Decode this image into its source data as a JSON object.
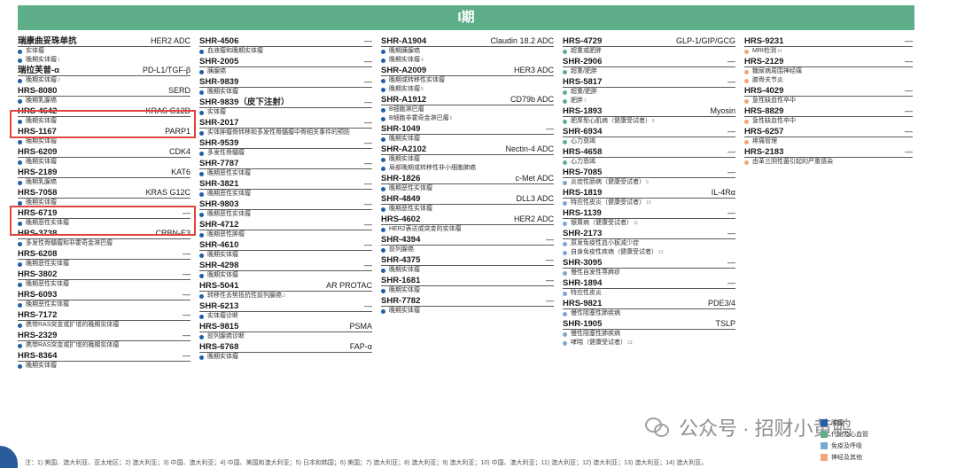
{
  "banner": {
    "title": "I期"
  },
  "colors": {
    "banner": "#5fae8a",
    "oncology": "#1f5fa8",
    "metabolic": "#5fae8a",
    "immunology": "#7ba7d6",
    "neuro": "#f2a57a",
    "highlight": "#e0453e"
  },
  "columns": [
    {
      "items": [
        {
          "code": "瑞康曲妥珠单抗",
          "target": "HER2 ADC",
          "ind": [
            {
              "text": "实体瘤",
              "c": "oncology"
            },
            {
              "text": "晚期实体瘤",
              "sup": "1",
              "c": "oncology"
            }
          ]
        },
        {
          "code": "瑞拉芙普-α",
          "target": "PD-L1/TGF-β",
          "ind": [
            {
              "text": "晚期实体瘤",
              "sup": "2",
              "c": "oncology"
            }
          ]
        },
        {
          "code": "HRS-8080",
          "target": "SERD",
          "ind": [
            {
              "text": "晚期乳腺癌",
              "c": "oncology"
            }
          ]
        },
        {
          "code": "HRS-4642",
          "target": "KRAS G12D",
          "ind": [
            {
              "text": "晚期实体瘤",
              "c": "oncology"
            }
          ]
        },
        {
          "code": "HRS-1167",
          "target": "PARP1",
          "ind": [
            {
              "text": "晚期实体瘤",
              "c": "oncology"
            }
          ]
        },
        {
          "code": "HRS-6209",
          "target": "CDK4",
          "ind": [
            {
              "text": "晚期实体瘤",
              "c": "oncology"
            }
          ]
        },
        {
          "code": "HRS-2189",
          "target": "KAT6",
          "ind": [
            {
              "text": "晚期乳腺癌",
              "c": "oncology"
            }
          ]
        },
        {
          "code": "HRS-7058",
          "target": "KRAS G12C",
          "ind": [
            {
              "text": "晚期实体瘤",
              "c": "oncology"
            }
          ]
        },
        {
          "code": "HRS-6719",
          "target": "—",
          "ind": [
            {
              "text": "晚期恶性实体瘤",
              "c": "oncology"
            }
          ]
        },
        {
          "code": "HRS-3738",
          "target": "CRBN-E3",
          "ind": [
            {
              "text": "多发性骨髓瘤和非霍奇金淋巴瘤",
              "c": "oncology"
            }
          ]
        },
        {
          "code": "HRS-6208",
          "target": "—",
          "ind": [
            {
              "text": "晚期恶性实体瘤",
              "c": "oncology"
            }
          ]
        },
        {
          "code": "HRS-3802",
          "target": "—",
          "ind": [
            {
              "text": "晚期恶性实体瘤",
              "c": "oncology"
            }
          ]
        },
        {
          "code": "HRS-6093",
          "target": "—",
          "ind": [
            {
              "text": "晚期恶性实体瘤",
              "c": "oncology"
            }
          ]
        },
        {
          "code": "HRS-7172",
          "target": "—",
          "ind": [
            {
              "text": "携带RAS突变或扩增的晚期实体瘤",
              "c": "oncology"
            }
          ]
        },
        {
          "code": "HRS-2329",
          "target": "—",
          "ind": [
            {
              "text": "携带RAS突变或扩增的晚期实体瘤",
              "c": "oncology"
            }
          ]
        },
        {
          "code": "HRS-8364",
          "target": "—",
          "ind": [
            {
              "text": "晚期实体瘤",
              "c": "oncology"
            }
          ]
        }
      ]
    },
    {
      "items": [
        {
          "code": "SHR-4506",
          "target": "—",
          "ind": [
            {
              "text": "血液瘤和晚期实体瘤",
              "c": "oncology"
            }
          ]
        },
        {
          "code": "SHR-2005",
          "target": "—",
          "ind": [
            {
              "text": "胰腺癌",
              "c": "oncology"
            }
          ]
        },
        {
          "code": "SHR-9839",
          "target": "—",
          "ind": [
            {
              "text": "晚期实体瘤",
              "c": "oncology"
            }
          ]
        },
        {
          "code": "SHR-9839（皮下注射）",
          "target": "—",
          "ind": [
            {
              "text": "实体瘤",
              "c": "oncology"
            }
          ]
        },
        {
          "code": "SHR-2017",
          "target": "—",
          "ind": [
            {
              "text": "实体肿瘤骨转移和多发性骨髓瘤中骨相关事件的预防",
              "c": "oncology"
            }
          ]
        },
        {
          "code": "SHR-9539",
          "target": "—",
          "ind": [
            {
              "text": "多发性骨髓瘤",
              "c": "oncology"
            }
          ]
        },
        {
          "code": "SHR-7787",
          "target": "—",
          "ind": [
            {
              "text": "晚期恶性实体瘤",
              "c": "oncology"
            }
          ]
        },
        {
          "code": "SHR-3821",
          "target": "—",
          "ind": [
            {
              "text": "晚期恶性实体瘤",
              "c": "oncology"
            }
          ]
        },
        {
          "code": "SHR-9803",
          "target": "—",
          "ind": [
            {
              "text": "晚期恶性实体瘤",
              "c": "oncology"
            }
          ]
        },
        {
          "code": "SHR-4712",
          "target": "—",
          "ind": [
            {
              "text": "晚期恶性肿瘤",
              "c": "oncology"
            }
          ]
        },
        {
          "code": "SHR-4610",
          "target": "—",
          "ind": [
            {
              "text": "晚期实体瘤",
              "c": "oncology"
            }
          ]
        },
        {
          "code": "SHR-4298",
          "target": "—",
          "ind": [
            {
              "text": "晚期实体瘤",
              "c": "oncology"
            }
          ]
        },
        {
          "code": "HRS-5041",
          "target": "AR PROTAC",
          "ind": [
            {
              "text": "转移性去势抵抗性前列腺癌",
              "sup": "3",
              "c": "oncology"
            }
          ]
        },
        {
          "code": "SHR-6213",
          "target": "—",
          "ind": [
            {
              "text": "实体瘤诊断",
              "c": "oncology"
            }
          ]
        },
        {
          "code": "HRS-9815",
          "target": "PSMA",
          "ind": [
            {
              "text": "前列腺癌诊断",
              "c": "oncology"
            }
          ]
        },
        {
          "code": "HRS-6768",
          "target": "FAP-α",
          "ind": [
            {
              "text": "晚期实体瘤",
              "c": "oncology"
            }
          ]
        }
      ]
    },
    {
      "items": [
        {
          "code": "SHR-A1904",
          "target": "Claudin 18.2 ADC",
          "ind": [
            {
              "text": "晚期胰腺癌",
              "c": "oncology"
            },
            {
              "text": "晚期实体瘤",
              "sup": "4",
              "c": "oncology"
            }
          ]
        },
        {
          "code": "SHR-A2009",
          "target": "HER3 ADC",
          "ind": [
            {
              "text": "晚期或转移性实体瘤",
              "c": "oncology"
            },
            {
              "text": "晚期实体瘤",
              "sup": "5",
              "c": "oncology"
            }
          ]
        },
        {
          "code": "SHR-A1912",
          "target": "CD79b ADC",
          "ind": [
            {
              "text": "B细胞淋巴瘤",
              "c": "oncology"
            },
            {
              "text": "B细胞非霍奇金淋巴瘤",
              "sup": "6",
              "c": "oncology"
            }
          ]
        },
        {
          "code": "SHR-1049",
          "target": "—",
          "ind": [
            {
              "text": "晚期实体瘤",
              "c": "oncology"
            }
          ]
        },
        {
          "code": "SHR-A2102",
          "target": "Nectin-4 ADC",
          "ind": [
            {
              "text": "晚期实体瘤",
              "c": "oncology"
            },
            {
              "text": "局部晚期或转移性非小细胞肺癌",
              "c": "oncology"
            }
          ]
        },
        {
          "code": "SHR-1826",
          "target": "c-Met ADC",
          "ind": [
            {
              "text": "晚期恶性实体瘤",
              "c": "oncology"
            }
          ]
        },
        {
          "code": "SHR-4849",
          "target": "DLL3 ADC",
          "ind": [
            {
              "text": "晚期恶性实体瘤",
              "c": "oncology"
            }
          ]
        },
        {
          "code": "HRS-4602",
          "target": "HER2 ADC",
          "ind": [
            {
              "text": "HER2表达或突变的实体瘤",
              "c": "oncology"
            }
          ]
        },
        {
          "code": "SHR-4394",
          "target": "—",
          "ind": [
            {
              "text": "前列腺癌",
              "c": "oncology"
            }
          ]
        },
        {
          "code": "SHR-4375",
          "target": "—",
          "ind": [
            {
              "text": "晚期实体瘤",
              "c": "oncology"
            }
          ]
        },
        {
          "code": "SHR-1681",
          "target": "—",
          "ind": [
            {
              "text": "晚期实体瘤",
              "c": "oncology"
            }
          ]
        },
        {
          "code": "SHR-7782",
          "target": "—",
          "ind": [
            {
              "text": "晚期实体瘤",
              "c": "oncology"
            }
          ]
        }
      ]
    },
    {
      "items": [
        {
          "code": "HRS-4729",
          "target": "GLP-1/GIP/GCG",
          "ind": [
            {
              "text": "超重或肥胖",
              "c": "metabolic"
            }
          ]
        },
        {
          "code": "SHR-2906",
          "target": "—",
          "ind": [
            {
              "text": "超重/肥胖",
              "c": "metabolic"
            }
          ]
        },
        {
          "code": "HRS-5817",
          "target": "—",
          "ind": [
            {
              "text": "超重/肥胖",
              "c": "metabolic"
            },
            {
              "text": "肥胖",
              "sup": "7",
              "c": "metabolic"
            }
          ]
        },
        {
          "code": "HRS-1893",
          "target": "Myosin",
          "ind": [
            {
              "text": "肥厚型心肌病（健康受试者）",
              "sup": "8",
              "c": "metabolic"
            }
          ]
        },
        {
          "code": "SHR-6934",
          "target": "—",
          "ind": [
            {
              "text": "心力衰竭",
              "c": "metabolic"
            }
          ]
        },
        {
          "code": "HRS-4658",
          "target": "—",
          "ind": [
            {
              "text": "心力衰竭",
              "c": "metabolic"
            }
          ]
        },
        {
          "code": "HRS-7085",
          "target": "—",
          "ind": [
            {
              "text": "炎症性肠病（健康受试者）",
              "sup": "9",
              "c": "immunology"
            }
          ]
        },
        {
          "code": "HRS-1819",
          "target": "IL-4Rα",
          "ind": [
            {
              "text": "特应性皮炎（健康受试者）",
              "sup": "10",
              "c": "immunology"
            }
          ]
        },
        {
          "code": "HRS-1139",
          "target": "—",
          "ind": [
            {
              "text": "银屑病（健康受试者）",
              "sup": "11",
              "c": "immunology"
            }
          ]
        },
        {
          "code": "SHR-2173",
          "target": "—",
          "ind": [
            {
              "text": "原发免疫性血小板减少症",
              "c": "immunology"
            },
            {
              "text": "自身免疫性疾病（健康受试者）",
              "sup": "12",
              "c": "immunology"
            }
          ]
        },
        {
          "code": "SHR-3095",
          "target": "—",
          "ind": [
            {
              "text": "慢性自发性荨麻疹",
              "c": "immunology"
            }
          ]
        },
        {
          "code": "SHR-1894",
          "target": "—",
          "ind": [
            {
              "text": "特应性皮炎",
              "c": "immunology"
            }
          ]
        },
        {
          "code": "HRS-9821",
          "target": "PDE3/4",
          "ind": [
            {
              "text": "慢性阻塞性肺疾病",
              "c": "immunology"
            }
          ]
        },
        {
          "code": "SHR-1905",
          "target": "TSLP",
          "ind": [
            {
              "text": "慢性阻塞性肺疾病",
              "c": "immunology"
            },
            {
              "text": "哮喘（健康受试者）",
              "sup": "13",
              "c": "immunology"
            }
          ]
        }
      ]
    },
    {
      "items": [
        {
          "code": "HRS-9231",
          "target": "—",
          "ind": [
            {
              "text": "MRI检测",
              "sup": "14",
              "c": "neuro"
            }
          ]
        },
        {
          "code": "HRS-2129",
          "target": "—",
          "ind": [
            {
              "text": "糖尿病周围神经痛",
              "c": "neuro"
            },
            {
              "text": "膝骨关节炎",
              "c": "neuro"
            }
          ]
        },
        {
          "code": "HRS-4029",
          "target": "—",
          "ind": [
            {
              "text": "急性缺血性卒中",
              "c": "neuro"
            }
          ]
        },
        {
          "code": "HRS-8829",
          "target": "—",
          "ind": [
            {
              "text": "急性缺血性卒中",
              "c": "neuro"
            }
          ]
        },
        {
          "code": "HRS-6257",
          "target": "—",
          "ind": [
            {
              "text": "疼痛管理",
              "c": "neuro"
            }
          ]
        },
        {
          "code": "HRS-2183",
          "target": "—",
          "ind": [
            {
              "text": "由革兰阴性菌引起的严重感染",
              "c": "neuro"
            }
          ]
        }
      ]
    }
  ],
  "legend": [
    {
      "text": "肿瘤",
      "c": "oncology"
    },
    {
      "text": "代谢及心血管",
      "c": "metabolic"
    },
    {
      "text": "免疫及呼吸",
      "c": "immunology"
    },
    {
      "text": "神经及其他",
      "c": "neuro"
    }
  ],
  "watermark": {
    "text": "公众号 · 招财小黄鸭"
  },
  "footnote": "注：1) 美国、澳大利亚、亚太地区；2) 澳大利亚；3) 中国、澳大利亚；4) 中国、美国和澳大利亚；5) 日本和韩国；6) 美国；7) 澳大利亚；8) 澳大利亚；9) 澳大利亚；10) 中国、澳大利亚；11) 澳大利亚；12) 澳大利亚；13) 澳大利亚；14) 澳大利亚。"
}
